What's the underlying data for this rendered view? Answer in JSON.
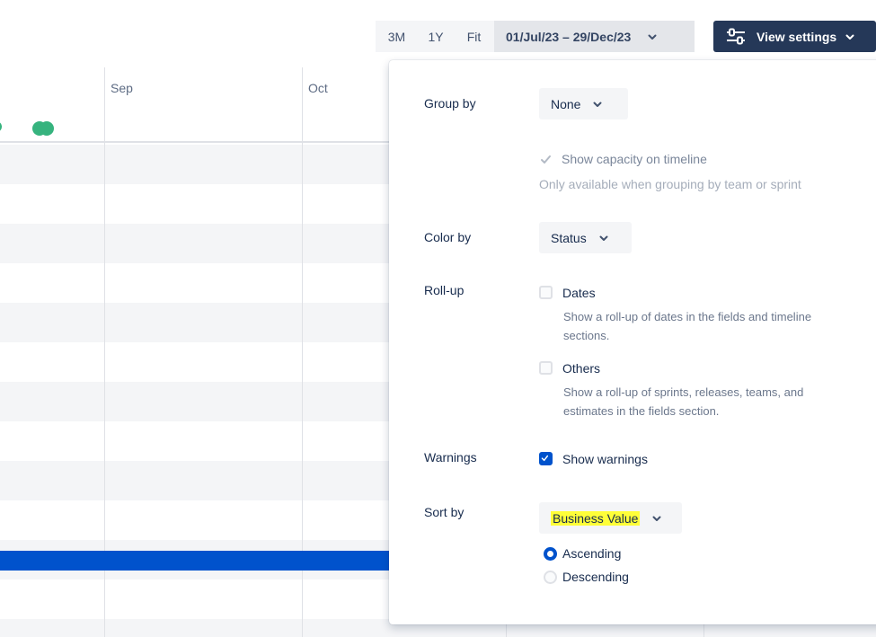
{
  "toolbar": {
    "range_buttons": [
      "3M",
      "1Y",
      "Fit"
    ],
    "date_range": "01/Jul/23 – 29/Dec/23",
    "view_settings_label": "View settings"
  },
  "timeline": {
    "months": [
      "Sep",
      "Oct"
    ]
  },
  "settings": {
    "group_by": {
      "label": "Group by",
      "value": "None"
    },
    "capacity": {
      "label": "Show capacity on timeline",
      "checked": true,
      "disabled": true,
      "help": "Only available when grouping by team or sprint"
    },
    "color_by": {
      "label": "Color by",
      "value": "Status"
    },
    "rollup": {
      "label": "Roll-up",
      "dates": {
        "label": "Dates",
        "checked": false,
        "help_line1": "Show a roll-up of dates in the fields and timeline",
        "help_line2": "sections."
      },
      "others": {
        "label": "Others",
        "checked": false,
        "help_line1": "Show a roll-up of sprints, releases, teams, and",
        "help_line2": "estimates in the fields section."
      }
    },
    "warnings": {
      "label": "Warnings",
      "option": "Show warnings",
      "checked": true
    },
    "sort_by": {
      "label": "Sort by",
      "value": "Business Value",
      "order_options": [
        "Ascending",
        "Descending"
      ],
      "selected": "Ascending"
    }
  },
  "colors": {
    "primary": "#0052cc",
    "navy": "#253858",
    "green_dot": "#36b37e",
    "highlight": "#ffff38"
  }
}
